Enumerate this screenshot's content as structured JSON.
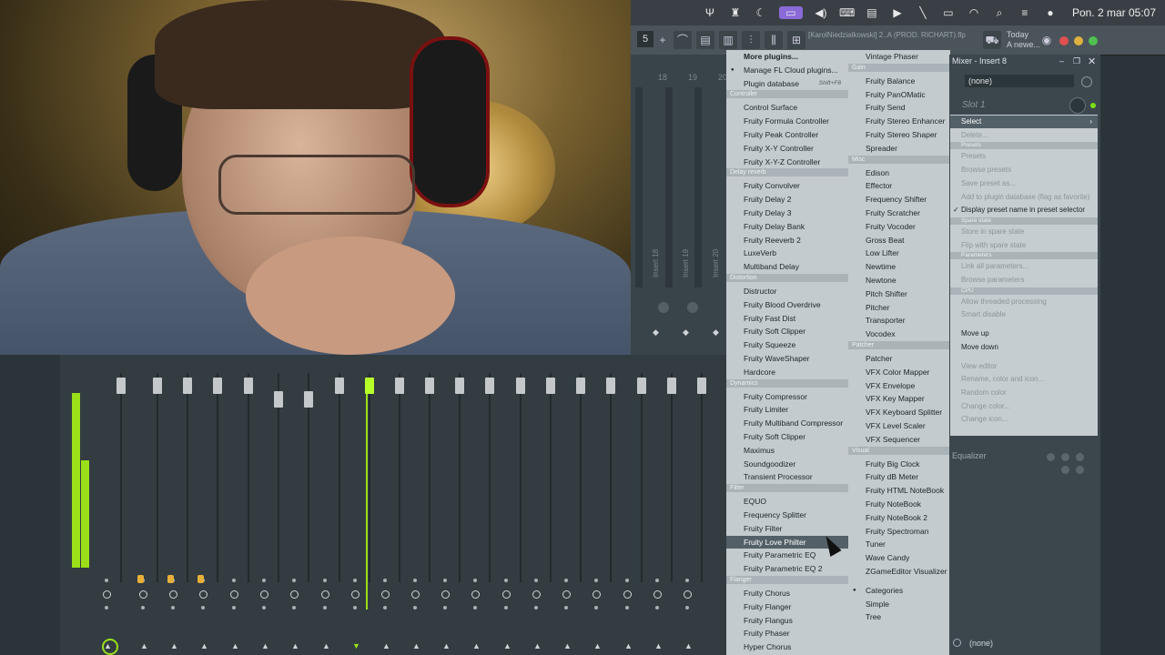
{
  "system_bar": {
    "icons": [
      "fork-icon",
      "tools-icon",
      "moon-icon",
      "screen-mirror-icon",
      "volume-icon",
      "keyboard-icon",
      "display-icon",
      "play-icon",
      "pen-icon",
      "battery-icon",
      "wifi-icon",
      "search-icon",
      "controlcenter-icon",
      "siri-icon"
    ],
    "datetime": "Pon. 2 mar  05:07"
  },
  "toolbar": {
    "pattern_number": "5",
    "plus": "+",
    "project_title": "[KarolNiedzialkowski] 2..A (PROD. RICHART).flp",
    "today_line1": "Today",
    "today_line2": "A newe..."
  },
  "playlist": {
    "numbers": [
      "18",
      "19",
      "20"
    ],
    "insert_labels": [
      "Insert 18",
      "Insert 19",
      "Insert 20"
    ]
  },
  "plugin_menu_col1": [
    {
      "type": "item",
      "label": "More plugins...",
      "bold": true
    },
    {
      "type": "item",
      "label": "Manage FL Cloud plugins...",
      "bullet": true
    },
    {
      "type": "item",
      "label": "Plugin database",
      "shortcut": "Shift+F8"
    },
    {
      "type": "hdr",
      "label": "Controller"
    },
    {
      "type": "item",
      "label": "Control Surface"
    },
    {
      "type": "item",
      "label": "Fruity Formula Controller"
    },
    {
      "type": "item",
      "label": "Fruity Peak Controller"
    },
    {
      "type": "item",
      "label": "Fruity X-Y Controller"
    },
    {
      "type": "item",
      "label": "Fruity X-Y-Z Controller"
    },
    {
      "type": "hdr",
      "label": "Delay reverb"
    },
    {
      "type": "item",
      "label": "Fruity Convolver"
    },
    {
      "type": "item",
      "label": "Fruity Delay 2"
    },
    {
      "type": "item",
      "label": "Fruity Delay 3"
    },
    {
      "type": "item",
      "label": "Fruity Delay Bank"
    },
    {
      "type": "item",
      "label": "Fruity Reeverb 2"
    },
    {
      "type": "item",
      "label": "LuxeVerb"
    },
    {
      "type": "item",
      "label": "Multiband Delay"
    },
    {
      "type": "hdr",
      "label": "Distortion"
    },
    {
      "type": "item",
      "label": "Distructor"
    },
    {
      "type": "item",
      "label": "Fruity Blood Overdrive"
    },
    {
      "type": "item",
      "label": "Fruity Fast Dist"
    },
    {
      "type": "item",
      "label": "Fruity Soft Clipper"
    },
    {
      "type": "item",
      "label": "Fruity Squeeze"
    },
    {
      "type": "item",
      "label": "Fruity WaveShaper"
    },
    {
      "type": "item",
      "label": "Hardcore"
    },
    {
      "type": "hdr",
      "label": "Dynamics"
    },
    {
      "type": "item",
      "label": "Fruity Compressor"
    },
    {
      "type": "item",
      "label": "Fruity Limiter"
    },
    {
      "type": "item",
      "label": "Fruity Multiband Compressor"
    },
    {
      "type": "item",
      "label": "Fruity Soft Clipper"
    },
    {
      "type": "item",
      "label": "Maximus"
    },
    {
      "type": "item",
      "label": "Soundgoodizer"
    },
    {
      "type": "item",
      "label": "Transient Processor"
    },
    {
      "type": "hdr",
      "label": "Filter"
    },
    {
      "type": "item",
      "label": "EQUO"
    },
    {
      "type": "item",
      "label": "Frequency Splitter"
    },
    {
      "type": "item",
      "label": "Fruity Filter"
    },
    {
      "type": "item",
      "label": "Fruity Love Philter",
      "highlight": true
    },
    {
      "type": "item",
      "label": "Fruity Parametric EQ"
    },
    {
      "type": "item",
      "label": "Fruity Parametric EQ 2"
    },
    {
      "type": "hdr",
      "label": "Flanger"
    },
    {
      "type": "item",
      "label": "Fruity Chorus"
    },
    {
      "type": "item",
      "label": "Fruity Flanger"
    },
    {
      "type": "item",
      "label": "Fruity Flangus"
    },
    {
      "type": "item",
      "label": "Fruity Phaser"
    },
    {
      "type": "item",
      "label": "Hyper Chorus"
    }
  ],
  "plugin_menu_col2": [
    {
      "type": "item",
      "label": "Vintage Phaser"
    },
    {
      "type": "hdr",
      "label": "Gain"
    },
    {
      "type": "item",
      "label": "Fruity Balance"
    },
    {
      "type": "item",
      "label": "Fruity PanOMatic"
    },
    {
      "type": "item",
      "label": "Fruity Send"
    },
    {
      "type": "item",
      "label": "Fruity Stereo Enhancer"
    },
    {
      "type": "item",
      "label": "Fruity Stereo Shaper"
    },
    {
      "type": "item",
      "label": "Spreader"
    },
    {
      "type": "hdr",
      "label": "Misc"
    },
    {
      "type": "item",
      "label": "Edison"
    },
    {
      "type": "item",
      "label": "Effector"
    },
    {
      "type": "item",
      "label": "Frequency Shifter"
    },
    {
      "type": "item",
      "label": "Fruity Scratcher"
    },
    {
      "type": "item",
      "label": "Fruity Vocoder"
    },
    {
      "type": "item",
      "label": "Gross Beat"
    },
    {
      "type": "item",
      "label": "Low Lifter"
    },
    {
      "type": "item",
      "label": "Newtime"
    },
    {
      "type": "item",
      "label": "Newtone"
    },
    {
      "type": "item",
      "label": "Pitch Shifter"
    },
    {
      "type": "item",
      "label": "Pitcher"
    },
    {
      "type": "item",
      "label": "Transporter"
    },
    {
      "type": "item",
      "label": "Vocodex"
    },
    {
      "type": "hdr",
      "label": "Patcher"
    },
    {
      "type": "item",
      "label": "Patcher"
    },
    {
      "type": "item",
      "label": "VFX Color Mapper"
    },
    {
      "type": "item",
      "label": "VFX Envelope"
    },
    {
      "type": "item",
      "label": "VFX Key Mapper"
    },
    {
      "type": "item",
      "label": "VFX Keyboard Splitter"
    },
    {
      "type": "item",
      "label": "VFX Level Scaler"
    },
    {
      "type": "item",
      "label": "VFX Sequencer"
    },
    {
      "type": "hdr",
      "label": "Visual"
    },
    {
      "type": "item",
      "label": "Fruity Big Clock"
    },
    {
      "type": "item",
      "label": "Fruity dB Meter"
    },
    {
      "type": "item",
      "label": "Fruity HTML NoteBook"
    },
    {
      "type": "item",
      "label": "Fruity NoteBook"
    },
    {
      "type": "item",
      "label": "Fruity NoteBook 2"
    },
    {
      "type": "item",
      "label": "Fruity Spectroman"
    },
    {
      "type": "item",
      "label": "Tuner"
    },
    {
      "type": "item",
      "label": "Wave Candy"
    },
    {
      "type": "item",
      "label": "ZGameEditor Visualizer"
    },
    {
      "type": "gap"
    },
    {
      "type": "item",
      "label": "Categories",
      "bullet": true
    },
    {
      "type": "item",
      "label": "Simple"
    },
    {
      "type": "item",
      "label": "Tree"
    }
  ],
  "mixer_panel": {
    "title": "Mixer - Insert 8",
    "preset_select": "(none)",
    "slot_label": "Slot 1",
    "equalizer_label": "Equalizer",
    "bottom_select": "(none)"
  },
  "slot_context_menu": [
    {
      "type": "item",
      "label": "Select",
      "selected": true,
      "arrow": "›"
    },
    {
      "type": "item",
      "label": "Delete...",
      "disabled": true
    },
    {
      "type": "hdr",
      "label": "Presets"
    },
    {
      "type": "item",
      "label": "Presets",
      "disabled": true
    },
    {
      "type": "item",
      "label": "Browse presets",
      "disabled": true
    },
    {
      "type": "item",
      "label": "Save preset as...",
      "disabled": true
    },
    {
      "type": "item",
      "label": "Add to plugin database (flag as favorite)",
      "disabled": true
    },
    {
      "type": "item",
      "label": "Display preset name in preset selector",
      "checked": true
    },
    {
      "type": "hdr",
      "label": "Spare state"
    },
    {
      "type": "item",
      "label": "Store in spare state",
      "disabled": true
    },
    {
      "type": "item",
      "label": "Flip with spare state",
      "disabled": true
    },
    {
      "type": "hdr",
      "label": "Parameters"
    },
    {
      "type": "item",
      "label": "Link all parameters...",
      "disabled": true
    },
    {
      "type": "item",
      "label": "Browse parameters",
      "disabled": true
    },
    {
      "type": "hdr",
      "label": "CPU"
    },
    {
      "type": "item",
      "label": "Allow threaded processing",
      "disabled": true
    },
    {
      "type": "item",
      "label": "Smart disable",
      "disabled": true
    },
    {
      "type": "gap"
    },
    {
      "type": "item",
      "label": "Move up"
    },
    {
      "type": "item",
      "label": "Move down"
    },
    {
      "type": "gap"
    },
    {
      "type": "item",
      "label": "View editor",
      "disabled": true
    },
    {
      "type": "item",
      "label": "Rename, color and icon...",
      "disabled": true
    },
    {
      "type": "item",
      "label": "Random color",
      "disabled": true
    },
    {
      "type": "item",
      "label": "Change color...",
      "disabled": true
    },
    {
      "type": "item",
      "label": "Change icon...",
      "disabled": true
    }
  ],
  "colors": {
    "meter_green": "#9adf1a",
    "menu_bg": "#c4cbcf",
    "highlight": "#536068",
    "accent_purple": "#8a6ad8"
  }
}
